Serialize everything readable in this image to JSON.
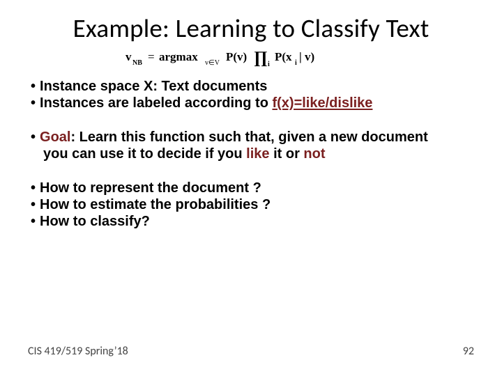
{
  "title": "Example: Learning to Classify Text",
  "formula": {
    "lhs_bold": "v",
    "lhs_sub": "NB",
    "eq": "=",
    "argmax": "argmax",
    "argmax_sub": "v∈V",
    "pv": "P(v)",
    "prod_sub": "i",
    "pxi": "P(x",
    "pxi_sub": "i",
    "pxi_tail": " | v)"
  },
  "b1": "Instance space X: Text documents",
  "b2a": "Instances are labeled according to ",
  "b2b": "f(x)=like/dislike",
  "b3a": "Goal",
  "b3b": ": Learn this function such that, given a new document",
  "b3c": "you can use it to decide if you ",
  "b3d": "like",
  "b3e": " it or ",
  "b3f": "not",
  "b4": "How to represent the document ?",
  "b5": "How to estimate the probabilities ?",
  "b6": "How to classify?",
  "footer_left": "CIS 419/519 Spring’18",
  "footer_right": "92"
}
